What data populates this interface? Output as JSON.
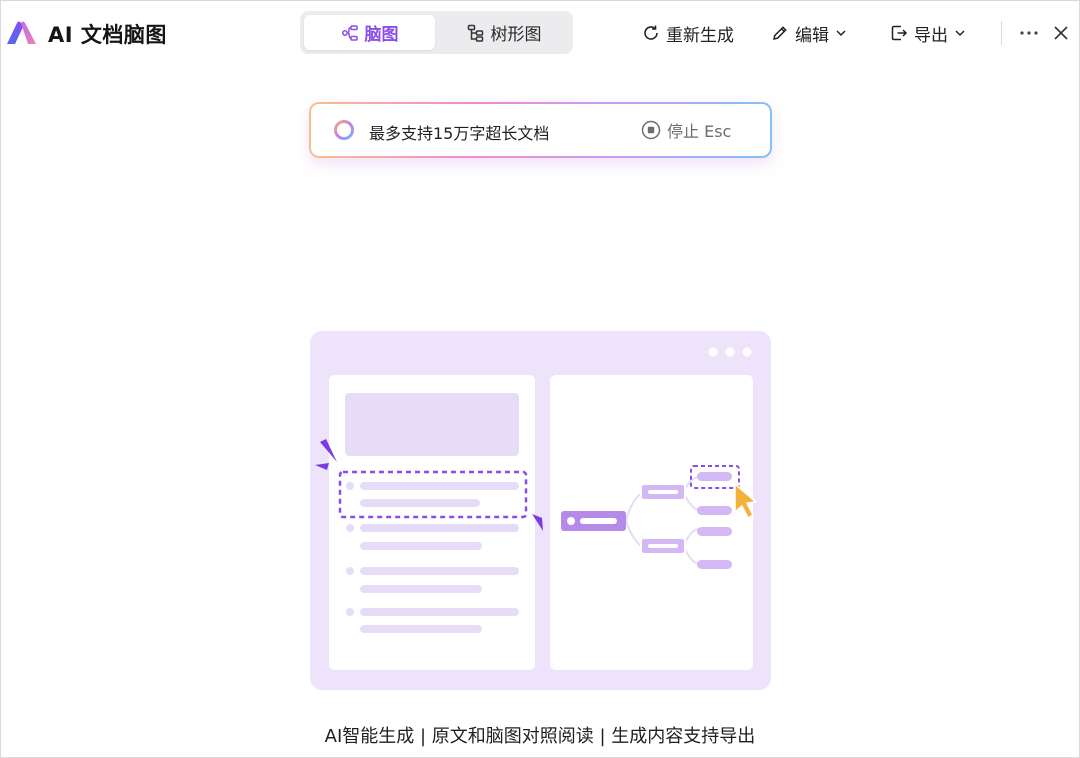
{
  "app": {
    "title": "AI 文档脑图"
  },
  "view_switch": {
    "mindmap_label": "脑图",
    "tree_label": "树形图",
    "selected": "mindmap"
  },
  "toolbar": {
    "regenerate_label": "重新生成",
    "edit_label": "编辑",
    "export_label": "导出"
  },
  "progress": {
    "message": "最多支持15万字超长文档",
    "stop_label": "停止 Esc"
  },
  "footer": {
    "caption": "AI智能生成 | 原文和脑图对照阅读 | 生成内容支持导出"
  },
  "colors": {
    "accent": "#8B4DEA",
    "illustration_bg": "#EDE4FB",
    "node": "#D3B8F3",
    "cursor": "#F2B33A"
  },
  "icons": [
    "logo-icon",
    "mindmap-icon",
    "tree-icon",
    "refresh-icon",
    "pencil-icon",
    "chevron-down-icon",
    "export-icon",
    "more-icon",
    "close-icon",
    "spinner-icon",
    "stop-icon",
    "cursor-icon"
  ]
}
